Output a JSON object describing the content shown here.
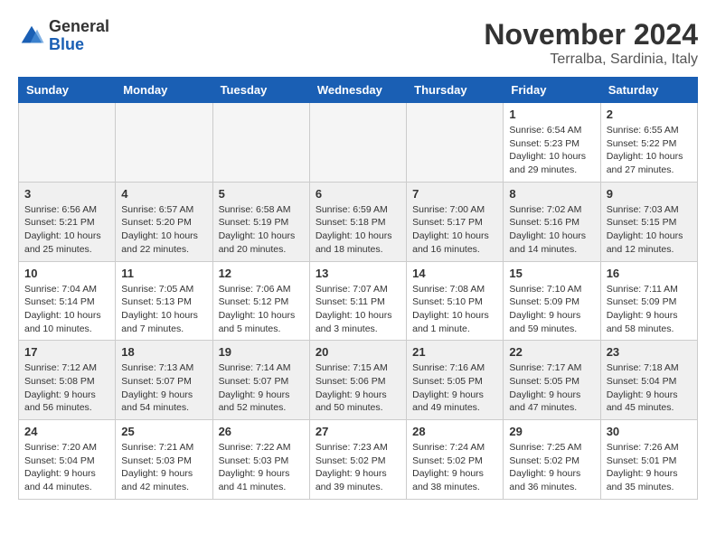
{
  "header": {
    "logo_general": "General",
    "logo_blue": "Blue",
    "month_title": "November 2024",
    "location": "Terralba, Sardinia, Italy"
  },
  "weekdays": [
    "Sunday",
    "Monday",
    "Tuesday",
    "Wednesday",
    "Thursday",
    "Friday",
    "Saturday"
  ],
  "weeks": [
    [
      {
        "day": "",
        "info": ""
      },
      {
        "day": "",
        "info": ""
      },
      {
        "day": "",
        "info": ""
      },
      {
        "day": "",
        "info": ""
      },
      {
        "day": "",
        "info": ""
      },
      {
        "day": "1",
        "info": "Sunrise: 6:54 AM\nSunset: 5:23 PM\nDaylight: 10 hours and 29 minutes."
      },
      {
        "day": "2",
        "info": "Sunrise: 6:55 AM\nSunset: 5:22 PM\nDaylight: 10 hours and 27 minutes."
      }
    ],
    [
      {
        "day": "3",
        "info": "Sunrise: 6:56 AM\nSunset: 5:21 PM\nDaylight: 10 hours and 25 minutes."
      },
      {
        "day": "4",
        "info": "Sunrise: 6:57 AM\nSunset: 5:20 PM\nDaylight: 10 hours and 22 minutes."
      },
      {
        "day": "5",
        "info": "Sunrise: 6:58 AM\nSunset: 5:19 PM\nDaylight: 10 hours and 20 minutes."
      },
      {
        "day": "6",
        "info": "Sunrise: 6:59 AM\nSunset: 5:18 PM\nDaylight: 10 hours and 18 minutes."
      },
      {
        "day": "7",
        "info": "Sunrise: 7:00 AM\nSunset: 5:17 PM\nDaylight: 10 hours and 16 minutes."
      },
      {
        "day": "8",
        "info": "Sunrise: 7:02 AM\nSunset: 5:16 PM\nDaylight: 10 hours and 14 minutes."
      },
      {
        "day": "9",
        "info": "Sunrise: 7:03 AM\nSunset: 5:15 PM\nDaylight: 10 hours and 12 minutes."
      }
    ],
    [
      {
        "day": "10",
        "info": "Sunrise: 7:04 AM\nSunset: 5:14 PM\nDaylight: 10 hours and 10 minutes."
      },
      {
        "day": "11",
        "info": "Sunrise: 7:05 AM\nSunset: 5:13 PM\nDaylight: 10 hours and 7 minutes."
      },
      {
        "day": "12",
        "info": "Sunrise: 7:06 AM\nSunset: 5:12 PM\nDaylight: 10 hours and 5 minutes."
      },
      {
        "day": "13",
        "info": "Sunrise: 7:07 AM\nSunset: 5:11 PM\nDaylight: 10 hours and 3 minutes."
      },
      {
        "day": "14",
        "info": "Sunrise: 7:08 AM\nSunset: 5:10 PM\nDaylight: 10 hours and 1 minute."
      },
      {
        "day": "15",
        "info": "Sunrise: 7:10 AM\nSunset: 5:09 PM\nDaylight: 9 hours and 59 minutes."
      },
      {
        "day": "16",
        "info": "Sunrise: 7:11 AM\nSunset: 5:09 PM\nDaylight: 9 hours and 58 minutes."
      }
    ],
    [
      {
        "day": "17",
        "info": "Sunrise: 7:12 AM\nSunset: 5:08 PM\nDaylight: 9 hours and 56 minutes."
      },
      {
        "day": "18",
        "info": "Sunrise: 7:13 AM\nSunset: 5:07 PM\nDaylight: 9 hours and 54 minutes."
      },
      {
        "day": "19",
        "info": "Sunrise: 7:14 AM\nSunset: 5:07 PM\nDaylight: 9 hours and 52 minutes."
      },
      {
        "day": "20",
        "info": "Sunrise: 7:15 AM\nSunset: 5:06 PM\nDaylight: 9 hours and 50 minutes."
      },
      {
        "day": "21",
        "info": "Sunrise: 7:16 AM\nSunset: 5:05 PM\nDaylight: 9 hours and 49 minutes."
      },
      {
        "day": "22",
        "info": "Sunrise: 7:17 AM\nSunset: 5:05 PM\nDaylight: 9 hours and 47 minutes."
      },
      {
        "day": "23",
        "info": "Sunrise: 7:18 AM\nSunset: 5:04 PM\nDaylight: 9 hours and 45 minutes."
      }
    ],
    [
      {
        "day": "24",
        "info": "Sunrise: 7:20 AM\nSunset: 5:04 PM\nDaylight: 9 hours and 44 minutes."
      },
      {
        "day": "25",
        "info": "Sunrise: 7:21 AM\nSunset: 5:03 PM\nDaylight: 9 hours and 42 minutes."
      },
      {
        "day": "26",
        "info": "Sunrise: 7:22 AM\nSunset: 5:03 PM\nDaylight: 9 hours and 41 minutes."
      },
      {
        "day": "27",
        "info": "Sunrise: 7:23 AM\nSunset: 5:02 PM\nDaylight: 9 hours and 39 minutes."
      },
      {
        "day": "28",
        "info": "Sunrise: 7:24 AM\nSunset: 5:02 PM\nDaylight: 9 hours and 38 minutes."
      },
      {
        "day": "29",
        "info": "Sunrise: 7:25 AM\nSunset: 5:02 PM\nDaylight: 9 hours and 36 minutes."
      },
      {
        "day": "30",
        "info": "Sunrise: 7:26 AM\nSunset: 5:01 PM\nDaylight: 9 hours and 35 minutes."
      }
    ]
  ]
}
